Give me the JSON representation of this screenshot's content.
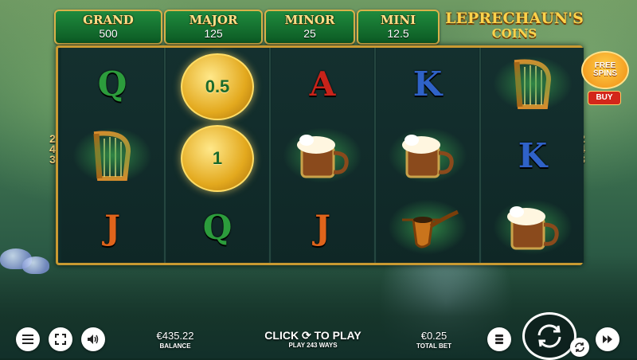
{
  "jackpots": [
    {
      "name": "GRAND",
      "value": "500"
    },
    {
      "name": "MAJOR",
      "value": "125"
    },
    {
      "name": "MINOR",
      "value": "25"
    },
    {
      "name": "MINI",
      "value": "12.5"
    }
  ],
  "logo": {
    "line1": "LEPRECHAUN'S",
    "line2": "COINS"
  },
  "ways_left": [
    "2",
    "4",
    "3"
  ],
  "ways_right": [
    "2",
    "4",
    "3"
  ],
  "reels": {
    "coin_values": [
      "0.5",
      "1"
    ],
    "letters": {
      "q1": "Q",
      "a": "A",
      "k1": "K",
      "j1": "J",
      "q2": "Q",
      "j2": "J",
      "k2": "K"
    }
  },
  "free_spins": {
    "line1": "FREE",
    "line2": "SPINS",
    "buy": "BUY"
  },
  "bottom": {
    "balance_value": "€435.22",
    "balance_label": "BALANCE",
    "click_to_play_a": "CLICK",
    "click_to_play_b": "TO PLAY",
    "play_ways": "PLAY 243 WAYS",
    "bet_value": "€0.25",
    "bet_label": "TOTAL BET"
  },
  "icons": [
    "menu-icon",
    "fullscreen-icon",
    "sound-icon",
    "coin-stack-icon",
    "spin-icon",
    "autoplay-icon",
    "fast-forward-icon"
  ],
  "colors": {
    "gold": "#d9b24a",
    "green": "#1f8a3d",
    "reel_bg": "#0f2b2a",
    "letter_red": "#c8231a",
    "letter_blue": "#2f62c8",
    "letter_green": "#2c9c3c",
    "letter_orange": "#e0641b"
  }
}
